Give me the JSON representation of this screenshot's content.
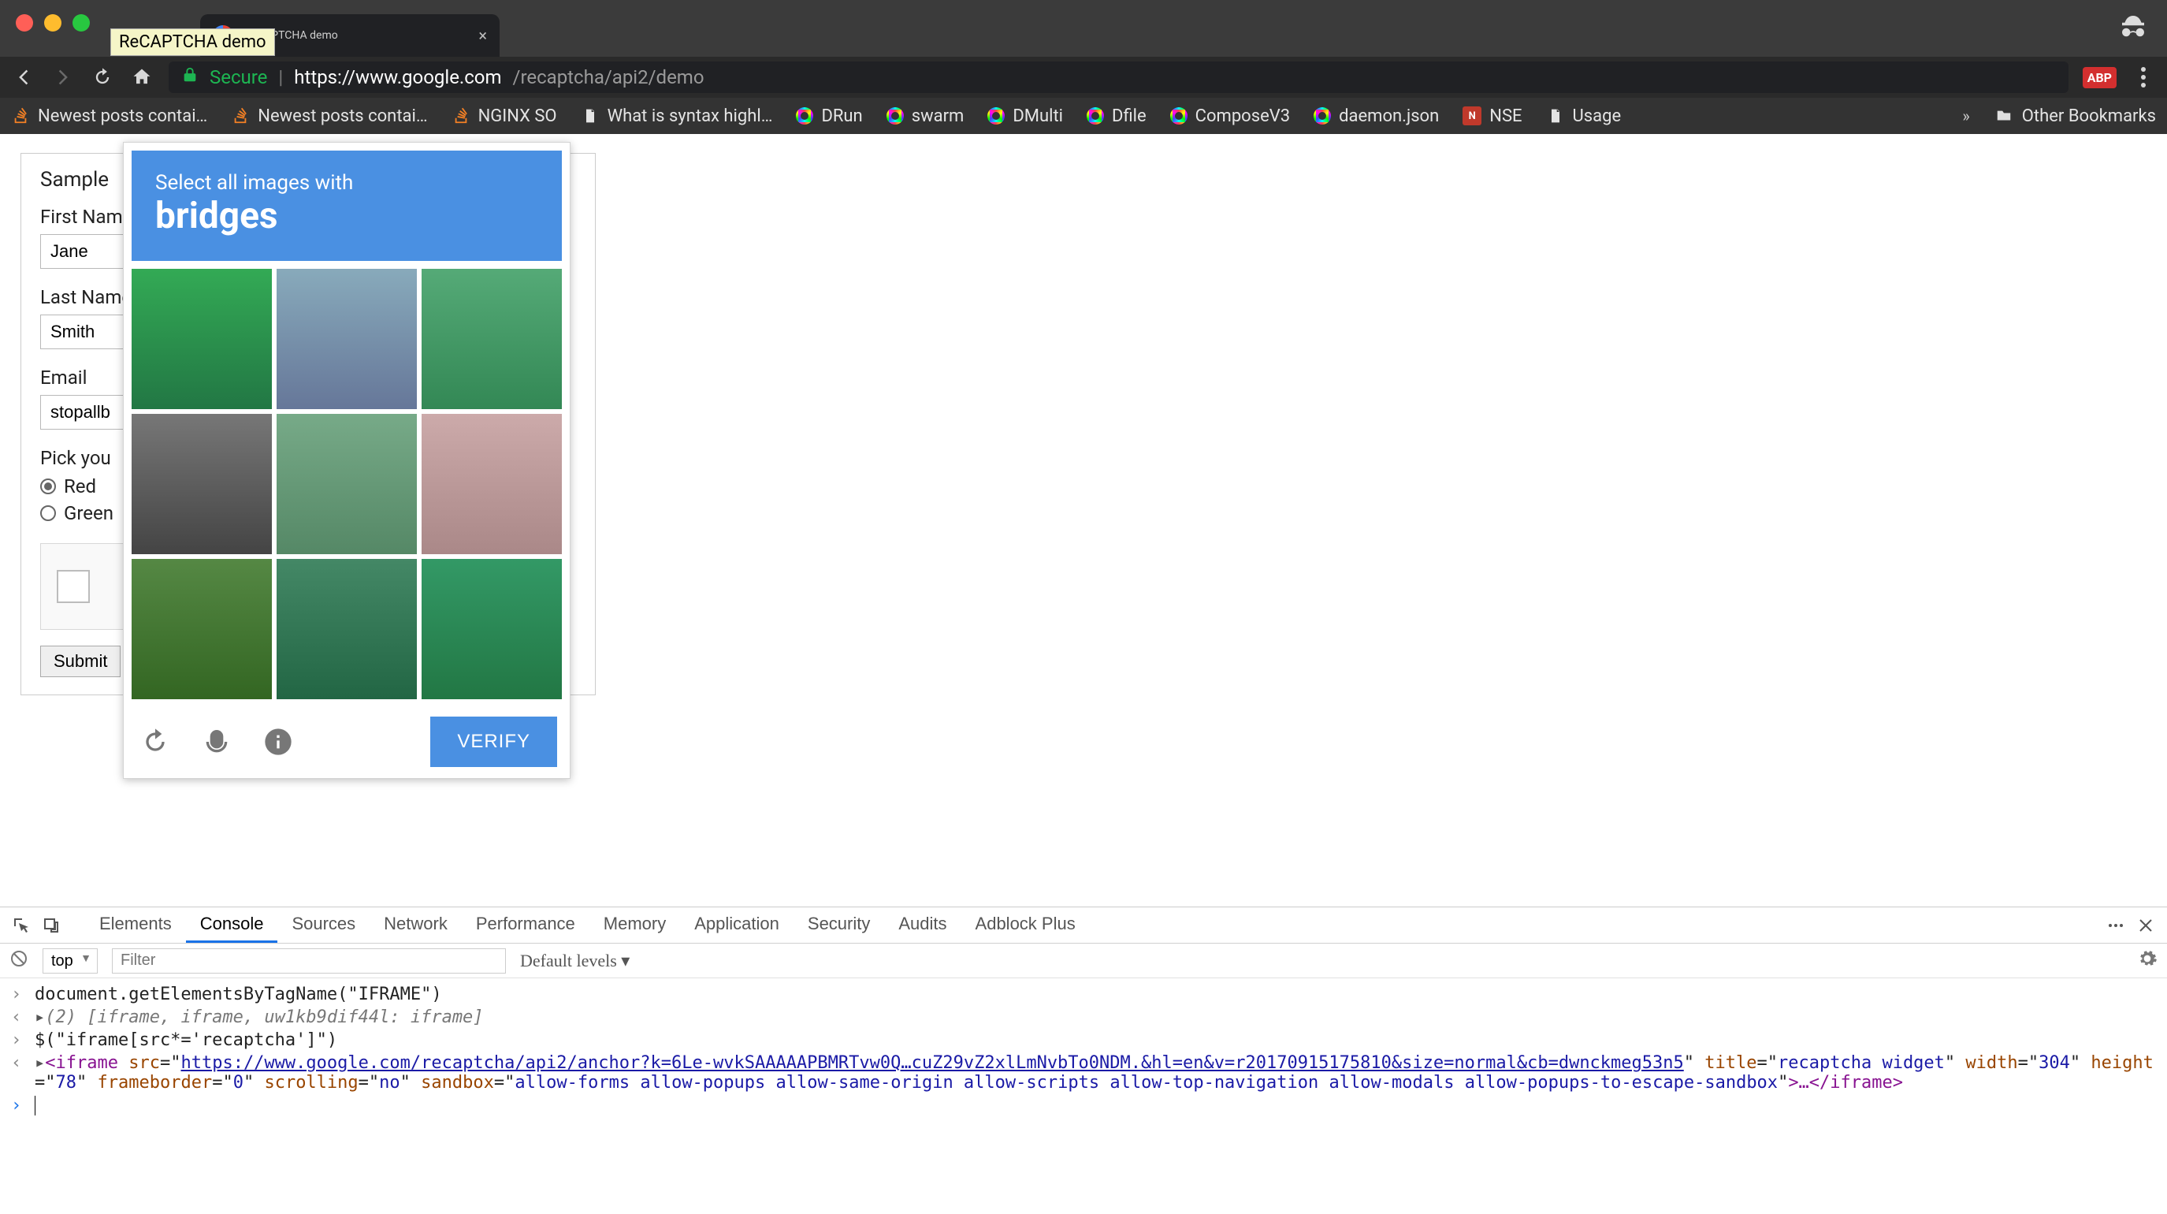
{
  "window": {
    "tab_title": "ReCAPTCHA demo",
    "tab_tooltip": "ReCAPTCHA demo"
  },
  "omnibox": {
    "secure_label": "Secure",
    "url_origin": "https://www.google.com",
    "url_path": "/recaptcha/api2/demo"
  },
  "toolbar_ext": {
    "abp_label": "ABP"
  },
  "bookmarks": {
    "items": [
      {
        "label": "Newest posts contai…",
        "icon": "so"
      },
      {
        "label": "Newest posts contai…",
        "icon": "so"
      },
      {
        "label": "NGINX SO",
        "icon": "so"
      },
      {
        "label": "What is syntax highl…",
        "icon": "doc"
      },
      {
        "label": "DRun",
        "icon": "rainbow"
      },
      {
        "label": "swarm",
        "icon": "rainbow"
      },
      {
        "label": "DMulti",
        "icon": "rainbow"
      },
      {
        "label": "Dfile",
        "icon": "rainbow"
      },
      {
        "label": "ComposeV3",
        "icon": "rainbow"
      },
      {
        "label": "daemon.json",
        "icon": "rainbow"
      },
      {
        "label": "NSE",
        "icon": "nse"
      },
      {
        "label": "Usage",
        "icon": "doc"
      }
    ],
    "overflow_glyph": "»",
    "other_label": "Other Bookmarks"
  },
  "form": {
    "heading": "Sample",
    "first_name_label": "First Name",
    "first_name_value": "Jane",
    "last_name_label": "Last Name",
    "last_name_value": "Smith",
    "email_label": "Email",
    "email_value": "stopallb",
    "pick_label": "Pick you",
    "radio_red": "Red",
    "radio_green": "Green",
    "submit_label": "Submit"
  },
  "captcha": {
    "line1": "Select all images with",
    "line2": "bridges",
    "verify_label": "VERIFY"
  },
  "devtools": {
    "tabs": [
      "Elements",
      "Console",
      "Sources",
      "Network",
      "Performance",
      "Memory",
      "Application",
      "Security",
      "Audits",
      "Adblock Plus"
    ],
    "active_tab": "Console",
    "context_selector": "top",
    "filter_placeholder": "Filter",
    "levels_label": "Default levels ▾",
    "lines": {
      "l1": "document.getElementsByTagName(\"IFRAME\")",
      "l2_prefix": "(2) ",
      "l2_body": "[iframe, iframe, uw1kb9dif44l: iframe]",
      "l3": "$(\"iframe[src*='recaptcha']\")",
      "l4_open": "<iframe ",
      "l4_src_key": "src",
      "l4_src_val": "https://www.google.com/recaptcha/api2/anchor?k=6Le-wvkSAAAAAPBMRTvw0Q…cuZ29vZ2xlLmNvbTo0NDM.&hl=en&v=r20170915175810&size=normal&cb=dwnckmeg53n5",
      "l4_title_key": "title",
      "l4_title_val": "recaptcha widget",
      "l4_width_key": "width",
      "l4_width_val": "304",
      "l4_height_key": "height",
      "l4_height_val": "78",
      "l4_fb_key": "frameborder",
      "l4_fb_val": "0",
      "l4_scroll_key": "scrolling",
      "l4_scroll_val": "no",
      "l4_sb_key": "sandbox",
      "l4_sb_val": "allow-forms allow-popups allow-same-origin allow-scripts allow-top-navigation allow-modals allow-popups-to-escape-sandbox",
      "l4_close": ">…</iframe>"
    }
  }
}
